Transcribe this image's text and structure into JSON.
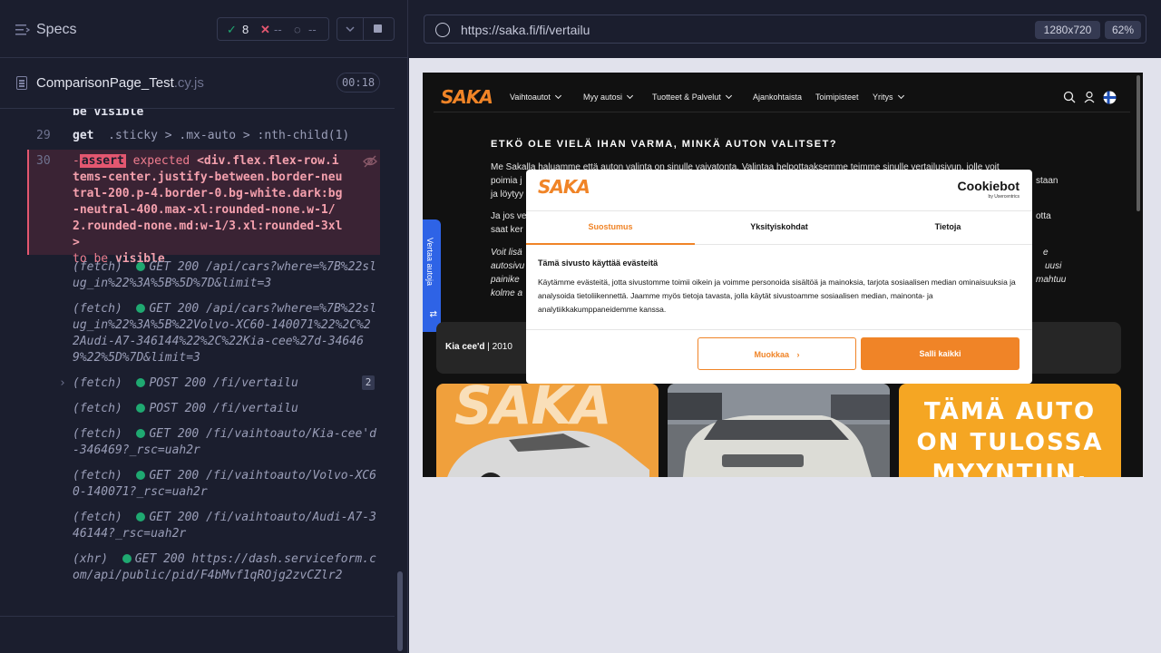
{
  "specs_header": {
    "title": "Specs",
    "passed": "8",
    "failed": "--",
    "pending": "--"
  },
  "spec_file": {
    "name": "ComparisonPage_Test",
    "ext": ".cy.js",
    "duration": "00:18"
  },
  "log": {
    "prev_tail": "be visible",
    "line29": {
      "num": "29",
      "cmd": "get",
      "arg": ".sticky > .mx-auto > :nth-child(1)"
    },
    "line30": {
      "num": "30",
      "prefix": "-",
      "badge": "assert",
      "expected": "expected",
      "selector": "<div.flex.flex-row.items-center.justify-between.border-neutral-200.p-4.border-0.bg-white.dark:bg-neutral-400.max-xl:rounded-none.w-1/2.rounded-none.md:w-1/3.xl:rounded-3xl>",
      "to_be": "to be",
      "visible": "visible"
    },
    "requests": [
      {
        "type": "(fetch)",
        "method": "GET 200",
        "path": "/api/cars?where=%7B%22slug_in%22%3A%5B%5D%7D&limit=3"
      },
      {
        "type": "(fetch)",
        "method": "GET 200",
        "path": "/api/cars?where=%7B%22slug_in%22%3A%5B%22Volvo-XC60-140071%22%2C%22Audi-A7-346144%22%2C%22Kia-cee%27d-346469%22%5D%7D&limit=3"
      },
      {
        "type": "(fetch)",
        "method": "POST 200",
        "path": "/fi/vertailu",
        "count": "2"
      },
      {
        "type": "(fetch)",
        "method": "POST 200",
        "path": "/fi/vertailu"
      },
      {
        "type": "(fetch)",
        "method": "GET 200",
        "path": "/fi/vaihtoauto/Kia-cee'd-346469?_rsc=uah2r"
      },
      {
        "type": "(fetch)",
        "method": "GET 200",
        "path": "/fi/vaihtoauto/Volvo-XC60-140071?_rsc=uah2r"
      },
      {
        "type": "(fetch)",
        "method": "GET 200",
        "path": "/fi/vaihtoauto/Audi-A7-346144?_rsc=uah2r"
      },
      {
        "type": "(xhr)",
        "method": "GET 200",
        "path": "https://dash.serviceform.com/api/public/pid/F4bMvf1qROjg2zvCZlr2"
      }
    ]
  },
  "browser": {
    "url": "https://saka.fi/fi/vertailu",
    "viewport": "1280x720",
    "zoom": "62%"
  },
  "site": {
    "logo": "SAKA",
    "nav": [
      "Vaihtoautot",
      "Myy autosi",
      "Tuotteet & Palvelut",
      "Ajankohtaista",
      "Toimipisteet",
      "Yritys"
    ],
    "heading": "ETKÖ OLE VIELÄ IHAN VARMA, MINKÄ AUTON VALITSET?",
    "para1a": "Me Sakalla haluamme että auton valinta on sinulle vaivatonta. Valintaa helpottaaksemme teimme sinulle vertailusivun, jolle voit",
    "para1b": "poimia j",
    "para1c": "ja löytyy",
    "para1_right": "staan",
    "para2a": "Ja jos ve",
    "para2b": "saat ker",
    "para2_right": "otta",
    "para3a": "Voit lisä",
    "para3b": "autosivu",
    "para3c": "painike",
    "para3d": "kolme a",
    "para3_right1": "e",
    "para3_right2": "uusi",
    "para3_right3": "mahtuu",
    "compare_tab": "Vertaa autoja",
    "car_strip_label": "Kia cee'd",
    "car_strip_year": "| 2010",
    "card3_text": "TÄMÄ AUTO ON TULOSSA MYYNTIIN."
  },
  "cookie": {
    "brand": "Cookiebot",
    "brand_sub": "by Usercentrics",
    "tabs": [
      "Suostumus",
      "Yksityiskohdat",
      "Tietoja"
    ],
    "heading": "Tämä sivusto käyttää evästeitä",
    "text": "Käytämme evästeitä, jotta sivustomme toimii oikein ja voimme personoida sisältöä ja mainoksia, tarjota sosiaalisen median ominaisuuksia ja analysoida tietoliikennettä. Jaamme myös tietoja tavasta, jolla käytät sivustoamme sosiaalisen median, mainonta- ja analytiikkakumppaneidemme kanssa.",
    "btn_customize": "Muokkaa",
    "btn_allow_all": "Salli kaikki"
  },
  "colors": {
    "accent": "#f08427",
    "pass": "#1fa971",
    "fail": "#e45770"
  }
}
